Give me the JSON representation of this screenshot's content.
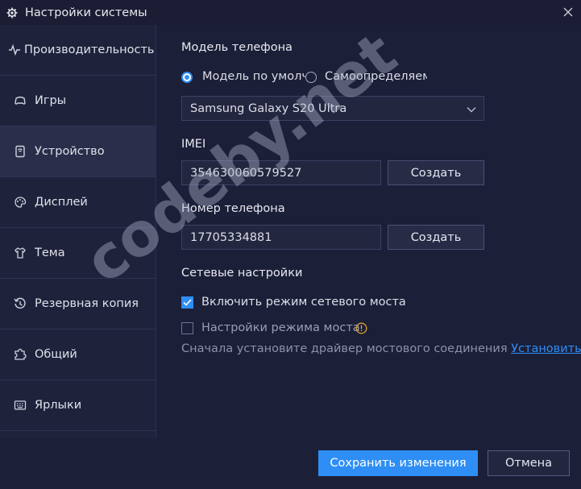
{
  "window": {
    "title": "Настройки системы"
  },
  "sidebar": {
    "items": [
      {
        "label": "Производительность",
        "icon": "pulse-icon"
      },
      {
        "label": "Игры",
        "icon": "gamepad-icon"
      },
      {
        "label": "Устройство",
        "icon": "phone-icon",
        "active": true
      },
      {
        "label": "Дисплей",
        "icon": "palette-icon"
      },
      {
        "label": "Тема",
        "icon": "shirt-icon"
      },
      {
        "label": "Резервная копия",
        "icon": "history-icon"
      },
      {
        "label": "Общий",
        "icon": "puzzle-icon"
      },
      {
        "label": "Ярлыки",
        "icon": "keyboard-icon"
      }
    ]
  },
  "device": {
    "phone_model_heading": "Модель телефона",
    "radio_default": "Модель по умолчанию",
    "radio_custom": "Самоопределяемая",
    "selected_model": "Samsung Galaxy S20 Ultra",
    "imei_heading": "IMEI",
    "imei_value": "354630060579527",
    "imei_create": "Создать",
    "phone_heading": "Номер телефона",
    "phone_value": "17705334881",
    "phone_create": "Создать",
    "network_heading": "Сетевые настройки",
    "bridge_mode": "Включить режим сетевого моста",
    "bridge_settings": "Настройки режима моста",
    "driver_hint": "Сначала установите драйвер мостового соединения",
    "install_link": "Установить"
  },
  "footer": {
    "save": "Сохранить изменения",
    "cancel": "Отмена"
  },
  "watermark": "codeby.net",
  "colors": {
    "accent": "#2f8ef5",
    "background": "#1c1f38",
    "sidebar": "#1f223b"
  }
}
